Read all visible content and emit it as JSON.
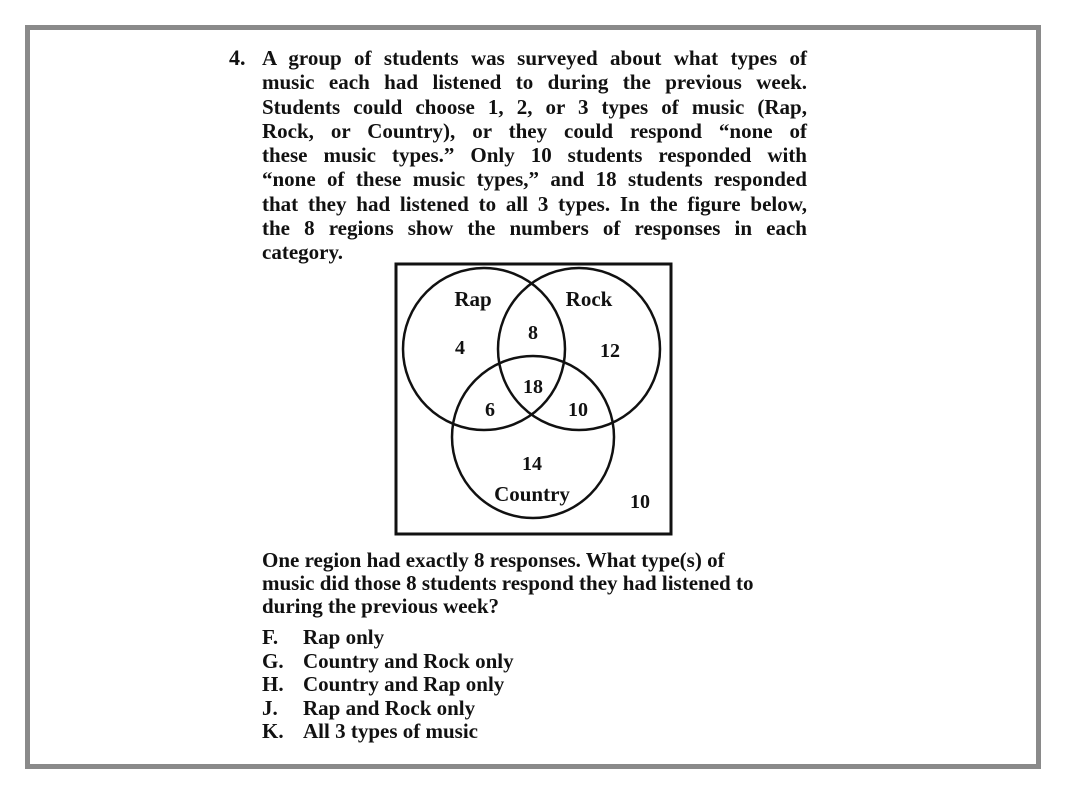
{
  "question": {
    "number": "4.",
    "stem_lines": [
      "A group of students was surveyed about what types of",
      "music each had listened to during the previous week.",
      "Students could choose 1, 2, or 3 types of music (Rap,",
      "Rock, or Country), or they could respond “none of",
      "these music types.” Only 10 students responded with",
      "“none of these music types,” and 18 students responded",
      "that they had listened to all 3 types. In the figure below,",
      "the 8 regions show the numbers of responses in each",
      "category."
    ],
    "prompt_lines": [
      "One region had exactly 8 responses. What type(s) of",
      "music did those 8 students respond they had listened to",
      "during the previous week?"
    ],
    "options": [
      {
        "letter": "F.",
        "text": "Rap only"
      },
      {
        "letter": "G.",
        "text": "Country and Rock only"
      },
      {
        "letter": "H.",
        "text": "Country and Rap only"
      },
      {
        "letter": "J.",
        "text": "Rap and Rock only"
      },
      {
        "letter": "K.",
        "text": "All 3 types of music"
      }
    ]
  },
  "venn": {
    "labels": {
      "rap": "Rap",
      "rock": "Rock",
      "country": "Country"
    },
    "regions": {
      "rap_only": "4",
      "rap_rock": "8",
      "rock_only": "12",
      "all_three": "18",
      "rap_country": "6",
      "rock_country": "10",
      "country_only": "14",
      "none": "10"
    }
  },
  "colors": {
    "frame_border": "#8a8a8a",
    "ink": "#111111"
  }
}
